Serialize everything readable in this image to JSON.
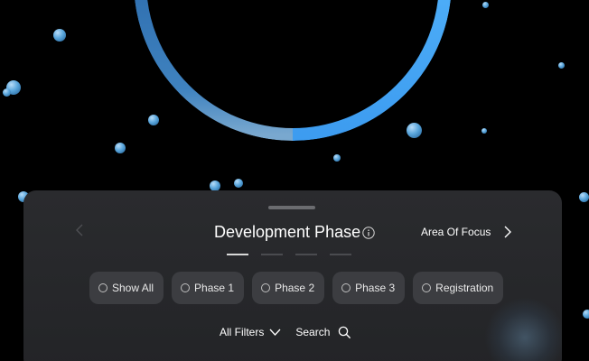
{
  "panel": {
    "title": "Development Phase",
    "area_of_focus": "Area Of Focus",
    "tabs_active_index": 0
  },
  "pills": [
    {
      "label": "Show All"
    },
    {
      "label": "Phase 1"
    },
    {
      "label": "Phase 2"
    },
    {
      "label": "Phase 3"
    },
    {
      "label": "Registration"
    }
  ],
  "filters": {
    "all_filters": "All Filters",
    "search": "Search"
  },
  "colors": {
    "ring_light": "#64b9ff",
    "ring_dark": "#3c82c8",
    "panel_bg": "#2a2b2e",
    "pill_bg": "#3c3d41"
  },
  "icons": {
    "prev": "chevron-left-icon",
    "info": "info-icon",
    "next": "chevron-right-icon",
    "filters": "chevron-down-icon",
    "search": "search-icon"
  }
}
